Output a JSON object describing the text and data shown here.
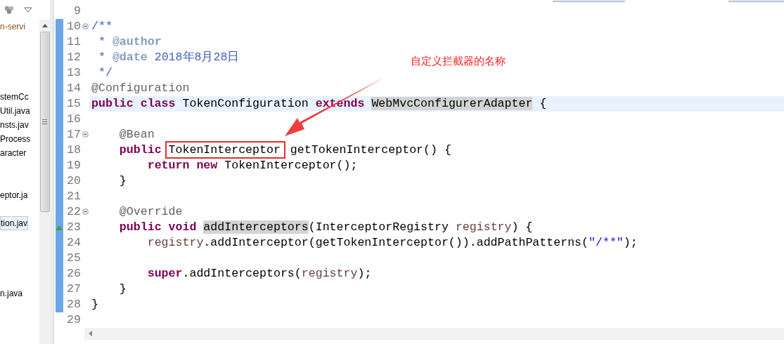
{
  "explorer": {
    "items": [
      {
        "label": "n-servi",
        "kind": "project",
        "selected": false
      },
      {
        "label": "stemCc",
        "kind": "file",
        "selected": false
      },
      {
        "label": "Util.java",
        "kind": "file",
        "selected": false
      },
      {
        "label": "nsts.jav",
        "kind": "file",
        "selected": false
      },
      {
        "label": "Process",
        "kind": "file",
        "selected": false
      },
      {
        "label": "aracter",
        "kind": "file",
        "selected": false
      },
      {
        "label": "eptor.ja",
        "kind": "file",
        "selected": false
      },
      {
        "label": "tion.jav",
        "kind": "file",
        "selected": true
      },
      {
        "label": "n.java",
        "kind": "file",
        "selected": false
      }
    ]
  },
  "editor": {
    "lines": [
      {
        "number": "9",
        "changed": false,
        "fold": false,
        "override": false,
        "current": false
      },
      {
        "number": "10",
        "changed": true,
        "fold": true,
        "override": false,
        "current": false,
        "segments": [
          {
            "text": "/**",
            "kind": "doc"
          }
        ]
      },
      {
        "number": "11",
        "changed": true,
        "fold": false,
        "override": false,
        "current": false,
        "segments": [
          {
            "text": " * ",
            "kind": "doc"
          },
          {
            "text": "@author",
            "kind": "doctag"
          }
        ]
      },
      {
        "number": "12",
        "changed": true,
        "fold": false,
        "override": false,
        "current": false,
        "segments": [
          {
            "text": " * ",
            "kind": "doc"
          },
          {
            "text": "@date",
            "kind": "doctag"
          },
          {
            "text": " 2018年8月28日",
            "kind": "doc"
          }
        ]
      },
      {
        "number": "13",
        "changed": true,
        "fold": false,
        "override": false,
        "current": false,
        "segments": [
          {
            "text": " */",
            "kind": "doc"
          }
        ]
      },
      {
        "number": "14",
        "changed": true,
        "fold": false,
        "override": false,
        "current": false,
        "segments": [
          {
            "text": "@Configuration",
            "kind": "annotation"
          }
        ]
      },
      {
        "number": "15",
        "changed": true,
        "fold": false,
        "override": false,
        "current": true,
        "segments": [
          {
            "text": "public class",
            "kind": "keyword"
          },
          {
            "text": " TokenConfiguration ",
            "kind": "plain"
          },
          {
            "text": "extends ",
            "kind": "keyword"
          },
          {
            "text": "WebMvcConfigurerAdapter",
            "kind": "occurrence"
          },
          {
            "text": " {",
            "kind": "plain"
          }
        ]
      },
      {
        "number": "16",
        "changed": true,
        "fold": false,
        "override": false,
        "current": false
      },
      {
        "number": "17",
        "changed": true,
        "fold": true,
        "override": false,
        "current": false,
        "segments": [
          {
            "text": "    @Bean",
            "kind": "annotation"
          }
        ]
      },
      {
        "number": "18",
        "changed": true,
        "fold": false,
        "override": false,
        "current": false,
        "segments": [
          {
            "text": "    public ",
            "kind": "keyword"
          },
          {
            "text": "TokenInterceptor",
            "kind": "boxed"
          },
          {
            "text": " getTokenInterceptor() {",
            "kind": "plain"
          }
        ]
      },
      {
        "number": "19",
        "changed": true,
        "fold": false,
        "override": false,
        "current": false,
        "segments": [
          {
            "text": "        return new",
            "kind": "keyword"
          },
          {
            "text": " TokenInterceptor();",
            "kind": "plain"
          }
        ]
      },
      {
        "number": "20",
        "changed": true,
        "fold": false,
        "override": false,
        "current": false,
        "segments": [
          {
            "text": "    }",
            "kind": "plain"
          }
        ]
      },
      {
        "number": "21",
        "changed": true,
        "fold": false,
        "override": false,
        "current": false
      },
      {
        "number": "22",
        "changed": true,
        "fold": true,
        "override": false,
        "current": false,
        "segments": [
          {
            "text": "    @Override",
            "kind": "annotation"
          }
        ]
      },
      {
        "number": "23",
        "changed": true,
        "fold": false,
        "override": true,
        "current": false,
        "segments": [
          {
            "text": "    public void ",
            "kind": "keyword"
          },
          {
            "text": "addInterceptors",
            "kind": "occurrence"
          },
          {
            "text": "(InterceptorRegistry ",
            "kind": "plain"
          },
          {
            "text": "registry",
            "kind": "param"
          },
          {
            "text": ") {",
            "kind": "plain"
          }
        ]
      },
      {
        "number": "24",
        "changed": true,
        "fold": false,
        "override": false,
        "current": false,
        "segments": [
          {
            "text": "        registry",
            "kind": "param"
          },
          {
            "text": ".addInterceptor(getTokenInterceptor()).addPathPatterns(",
            "kind": "plain"
          },
          {
            "text": "\"/**\"",
            "kind": "string"
          },
          {
            "text": ");",
            "kind": "plain"
          }
        ]
      },
      {
        "number": "25",
        "changed": true,
        "fold": false,
        "override": false,
        "current": false
      },
      {
        "number": "26",
        "changed": true,
        "fold": false,
        "override": false,
        "current": false,
        "segments": [
          {
            "text": "        super",
            "kind": "keyword"
          },
          {
            "text": ".addInterceptors(",
            "kind": "plain"
          },
          {
            "text": "registry",
            "kind": "param"
          },
          {
            "text": ");",
            "kind": "plain"
          }
        ]
      },
      {
        "number": "27",
        "changed": true,
        "fold": false,
        "override": false,
        "current": false,
        "segments": [
          {
            "text": "    }",
            "kind": "plain"
          }
        ]
      },
      {
        "number": "28",
        "changed": true,
        "fold": false,
        "override": false,
        "current": false,
        "segments": [
          {
            "text": "}",
            "kind": "plain"
          }
        ]
      },
      {
        "number": "29",
        "changed": false,
        "fold": false,
        "override": false,
        "current": false
      }
    ]
  },
  "callout": {
    "text": "自定义拦截器的名称"
  }
}
